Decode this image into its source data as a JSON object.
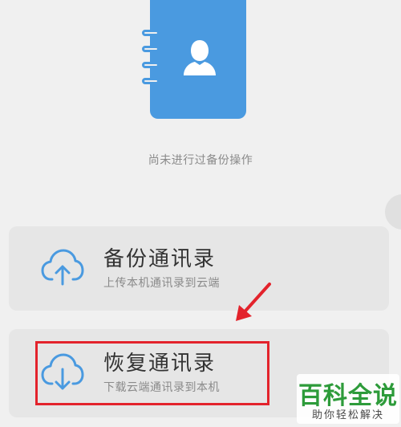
{
  "empty_state": {
    "status_text": "尚未进行过备份操作"
  },
  "actions": [
    {
      "title": "备份通讯录",
      "subtitle": "上传本机通讯录到云端",
      "icon": "cloud-upload-icon"
    },
    {
      "title": "恢复通讯录",
      "subtitle": "下载云端通讯录到本机",
      "icon": "cloud-download-icon"
    }
  ],
  "watermark": {
    "main": "百科全说",
    "sub": "助你轻松解决"
  },
  "colors": {
    "accent_blue": "#4a9ae0",
    "highlight_red": "#e3232c",
    "watermark_green": "#2d9b3a"
  }
}
